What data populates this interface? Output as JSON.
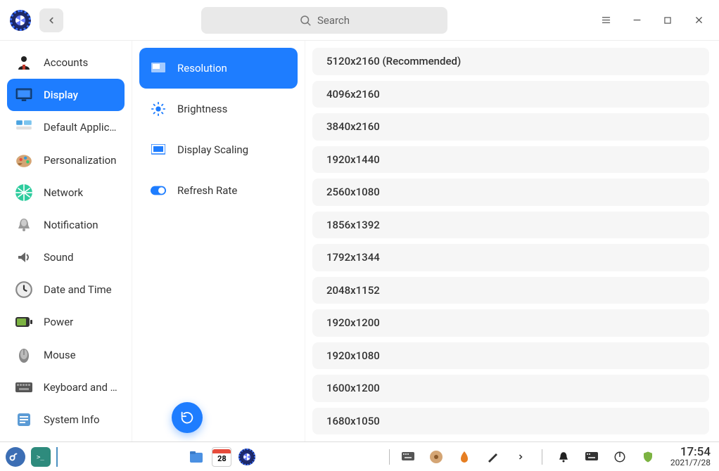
{
  "header": {
    "search_placeholder": "Search"
  },
  "sidebar": {
    "items": [
      {
        "label": "Accounts",
        "icon": "person"
      },
      {
        "label": "Display",
        "icon": "display",
        "active": true
      },
      {
        "label": "Default Applic...",
        "icon": "apps"
      },
      {
        "label": "Personalization",
        "icon": "palette"
      },
      {
        "label": "Network",
        "icon": "network"
      },
      {
        "label": "Notification",
        "icon": "bell"
      },
      {
        "label": "Sound",
        "icon": "sound"
      },
      {
        "label": "Date and Time",
        "icon": "clock"
      },
      {
        "label": "Power",
        "icon": "battery"
      },
      {
        "label": "Mouse",
        "icon": "mouse"
      },
      {
        "label": "Keyboard and ...",
        "icon": "keyboard"
      },
      {
        "label": "System Info",
        "icon": "info"
      }
    ]
  },
  "subpanel": {
    "items": [
      {
        "label": "Resolution",
        "icon": "resolution",
        "active": true
      },
      {
        "label": "Brightness",
        "icon": "brightness"
      },
      {
        "label": "Display Scaling",
        "icon": "scaling"
      },
      {
        "label": "Refresh Rate",
        "icon": "toggle"
      }
    ]
  },
  "resolutions": [
    "5120x2160 (Recommended)",
    "4096x2160",
    "3840x2160",
    "1920x1440",
    "2560x1080",
    "1856x1392",
    "1792x1344",
    "2048x1152",
    "1920x1200",
    "1920x1080",
    "1600x1200",
    "1680x1050"
  ],
  "taskbar": {
    "time": "17:54",
    "date": "2021/7/28",
    "calendar_day": "28"
  }
}
